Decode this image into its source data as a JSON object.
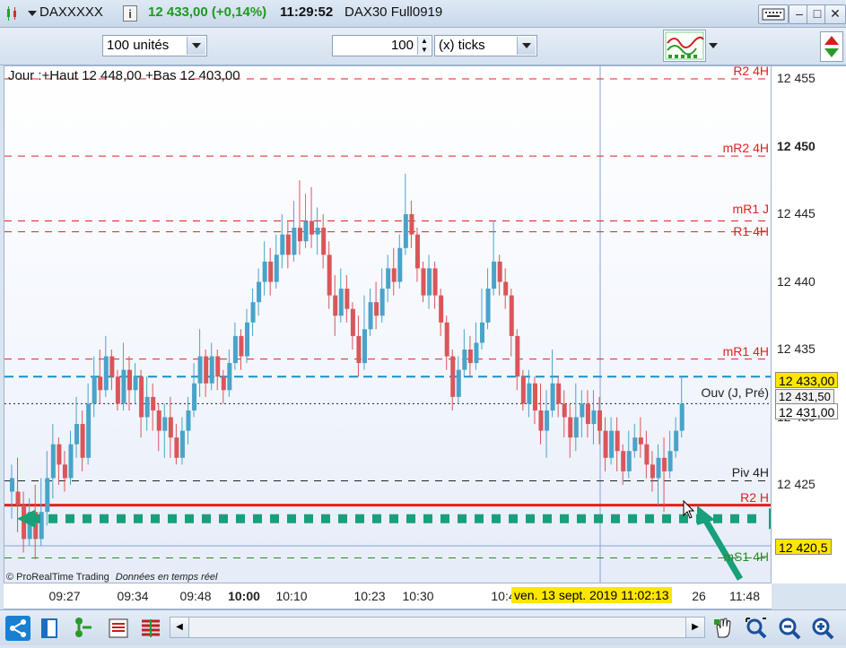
{
  "titlebar": {
    "symbol": "DAXXXXX",
    "info_icon": "i",
    "price_change": "12 433,00 (+0,14%)",
    "time": "11:29:52",
    "contract": "DAX30 Full0919",
    "keyboard_icon": "keyboard-icon",
    "minimize": "–",
    "maximize": "□",
    "close": "✕"
  },
  "toolbar": {
    "units_value": "100 unités",
    "ticks_value": "100",
    "ticks_unit": "(x) ticks"
  },
  "chart": {
    "info_line": "Jour :+Haut 12 448,00 +Bas 12 403,00",
    "copyright": "© ProRealTime Trading",
    "realtime_note": "Données en temps réel",
    "date_label": "ven. 13 sept. 2019 11:02:13"
  },
  "levels": [
    {
      "label": "R2 4H",
      "price": 12455,
      "color": "#e02020"
    },
    {
      "label": "mR2 4H",
      "price": 12449.3,
      "color": "#e02020"
    },
    {
      "label": "mR1 J",
      "price": 12444.5,
      "color": "#e02020"
    },
    {
      "label": "R1 4H",
      "price": 12443.7,
      "color": "#e02020"
    },
    {
      "label": "mR1 4H",
      "price": 12434.3,
      "color": "#e02020"
    },
    {
      "label": "Ouv (J, Pré)",
      "price": 12431.0,
      "color": "#222222"
    },
    {
      "label": "Piv 4H",
      "price": 12425.3,
      "color": "#222222"
    },
    {
      "label": "R2 H",
      "price": 12423.5,
      "color": "#e02020"
    },
    {
      "label": "mS1 4H",
      "price": 12419.6,
      "color": "#2a8a2a"
    }
  ],
  "price_axis": {
    "ticks": [
      "12 455",
      "12 450",
      "12 445",
      "12 440",
      "12 435",
      "12 430",
      "12 425"
    ],
    "current_price": "12 433,00",
    "open_price": "12 431,50",
    "crosshair_price": "12 431,00",
    "cursor_price": "12 420,5"
  },
  "time_axis": {
    "labels": [
      "09:27",
      "09:34",
      "09:48",
      "10:00",
      "10:10",
      "10:23",
      "10:30",
      "10:4",
      "26",
      "11:48"
    ]
  },
  "chart_data": {
    "type": "candlestick",
    "ylim": [
      12418.5,
      12456
    ],
    "candles": [
      [
        12424.5,
        12425.5,
        12422.5,
        12426.5
      ],
      [
        12424.5,
        12423.5,
        12421.5,
        12427.0
      ],
      [
        12423.5,
        12421.0,
        12420.0,
        12424.5
      ],
      [
        12421.0,
        12423.0,
        12420.5,
        12424.0
      ],
      [
        12423.0,
        12421.0,
        12419.5,
        12425.0
      ],
      [
        12421.0,
        12423.0,
        12420.5,
        12425.5
      ],
      [
        12423.0,
        12425.5,
        12422.0,
        12427.5
      ],
      [
        12425.5,
        12428.0,
        12424.0,
        12429.5
      ],
      [
        12428.0,
        12426.5,
        12425.0,
        12428.5
      ],
      [
        12426.5,
        12425.5,
        12424.5,
        12427.5
      ],
      [
        12425.5,
        12428.0,
        12425.0,
        12429.0
      ],
      [
        12428.0,
        12429.5,
        12427.0,
        12431.5
      ],
      [
        12429.5,
        12427.0,
        12426.0,
        12430.5
      ],
      [
        12427.0,
        12431.0,
        12426.5,
        12432.5
      ],
      [
        12431.0,
        12433.0,
        12430.0,
        12434.5
      ],
      [
        12433.0,
        12432.0,
        12431.0,
        12435.0
      ],
      [
        12432.0,
        12434.5,
        12431.5,
        12436.0
      ],
      [
        12434.5,
        12433.0,
        12432.0,
        12435.0
      ],
      [
        12433.0,
        12431.0,
        12430.5,
        12433.5
      ],
      [
        12431.0,
        12433.5,
        12430.5,
        12435.5
      ],
      [
        12433.5,
        12432.0,
        12430.5,
        12434.5
      ],
      [
        12432.0,
        12433.0,
        12431.0,
        12434.0
      ],
      [
        12433.0,
        12430.0,
        12428.5,
        12433.5
      ],
      [
        12430.0,
        12431.5,
        12429.0,
        12433.0
      ],
      [
        12431.5,
        12430.5,
        12429.0,
        12432.5
      ],
      [
        12430.5,
        12429.0,
        12427.5,
        12431.0
      ],
      [
        12429.0,
        12430.0,
        12427.0,
        12431.0
      ],
      [
        12430.0,
        12428.5,
        12427.0,
        12431.5
      ],
      [
        12428.5,
        12427.0,
        12426.5,
        12429.5
      ],
      [
        12427.0,
        12429.0,
        12426.5,
        12430.0
      ],
      [
        12429.0,
        12430.5,
        12428.0,
        12431.5
      ],
      [
        12430.5,
        12432.5,
        12430.0,
        12434.0
      ],
      [
        12432.5,
        12434.5,
        12431.5,
        12436.5
      ],
      [
        12434.5,
        12432.5,
        12431.5,
        12435.0
      ],
      [
        12432.5,
        12434.5,
        12432.0,
        12435.5
      ],
      [
        12434.5,
        12433.0,
        12432.0,
        12435.0
      ],
      [
        12433.0,
        12432.0,
        12431.0,
        12433.5
      ],
      [
        12432.0,
        12434.0,
        12431.5,
        12435.0
      ],
      [
        12434.0,
        12436.0,
        12433.5,
        12437.0
      ],
      [
        12436.0,
        12434.5,
        12433.5,
        12436.5
      ],
      [
        12434.5,
        12437.0,
        12434.0,
        12438.0
      ],
      [
        12437.0,
        12438.5,
        12436.0,
        12439.5
      ],
      [
        12438.5,
        12440.0,
        12437.5,
        12441.0
      ],
      [
        12440.0,
        12441.5,
        12439.0,
        12443.0
      ],
      [
        12441.5,
        12440.0,
        12439.0,
        12442.5
      ],
      [
        12440.0,
        12442.0,
        12439.5,
        12443.5
      ],
      [
        12442.0,
        12443.5,
        12441.0,
        12445.0
      ],
      [
        12443.5,
        12442.0,
        12441.0,
        12444.5
      ],
      [
        12442.0,
        12444.0,
        12441.5,
        12446.0
      ],
      [
        12444.0,
        12443.0,
        12442.0,
        12447.5
      ],
      [
        12443.0,
        12444.5,
        12442.5,
        12446.5
      ],
      [
        12444.5,
        12443.5,
        12442.5,
        12447.0
      ],
      [
        12443.5,
        12444.0,
        12442.0,
        12445.5
      ],
      [
        12444.0,
        12442.0,
        12441.0,
        12445.0
      ],
      [
        12442.0,
        12439.0,
        12438.0,
        12443.0
      ],
      [
        12439.0,
        12437.5,
        12436.0,
        12440.5
      ],
      [
        12437.5,
        12439.5,
        12437.0,
        12441.0
      ],
      [
        12439.5,
        12438.0,
        12437.0,
        12440.5
      ],
      [
        12438.0,
        12436.0,
        12435.0,
        12438.5
      ],
      [
        12436.0,
        12434.0,
        12433.0,
        12437.5
      ],
      [
        12434.0,
        12436.5,
        12433.5,
        12439.0
      ],
      [
        12436.5,
        12438.5,
        12436.0,
        12439.5
      ],
      [
        12438.5,
        12437.5,
        12436.5,
        12440.0
      ],
      [
        12437.5,
        12439.5,
        12437.0,
        12441.0
      ],
      [
        12439.5,
        12441.0,
        12438.5,
        12442.0
      ],
      [
        12441.0,
        12440.0,
        12439.0,
        12442.5
      ],
      [
        12440.0,
        12442.5,
        12439.5,
        12443.5
      ],
      [
        12442.5,
        12445.0,
        12442.0,
        12448.0
      ],
      [
        12445.0,
        12443.5,
        12442.5,
        12446.0
      ],
      [
        12443.5,
        12441.0,
        12440.0,
        12444.0
      ],
      [
        12441.0,
        12439.0,
        12438.5,
        12441.5
      ],
      [
        12439.0,
        12441.0,
        12438.0,
        12442.0
      ],
      [
        12441.0,
        12439.0,
        12438.0,
        12441.5
      ],
      [
        12439.0,
        12437.0,
        12436.0,
        12439.5
      ],
      [
        12437.0,
        12434.5,
        12433.5,
        12437.5
      ],
      [
        12434.5,
        12431.5,
        12430.5,
        12435.0
      ],
      [
        12431.5,
        12433.5,
        12431.0,
        12434.5
      ],
      [
        12433.5,
        12435.0,
        12433.0,
        12436.5
      ],
      [
        12435.0,
        12434.0,
        12433.0,
        12436.0
      ],
      [
        12434.0,
        12435.5,
        12433.5,
        12437.0
      ],
      [
        12435.5,
        12437.0,
        12435.0,
        12439.5
      ],
      [
        12437.0,
        12439.5,
        12436.5,
        12441.0
      ],
      [
        12439.5,
        12441.5,
        12439.0,
        12444.5
      ],
      [
        12441.5,
        12440.0,
        12439.0,
        12442.0
      ],
      [
        12440.0,
        12439.0,
        12438.0,
        12441.0
      ],
      [
        12439.0,
        12436.0,
        12434.5,
        12439.5
      ],
      [
        12436.0,
        12433.0,
        12432.0,
        12436.5
      ],
      [
        12433.0,
        12431.0,
        12430.5,
        12433.5
      ],
      [
        12431.0,
        12432.5,
        12430.0,
        12433.5
      ],
      [
        12432.5,
        12430.5,
        12429.5,
        12433.0
      ],
      [
        12430.5,
        12429.0,
        12428.0,
        12432.5
      ],
      [
        12429.0,
        12430.5,
        12427.0,
        12432.0
      ],
      [
        12430.5,
        12432.5,
        12430.0,
        12435.0
      ],
      [
        12432.5,
        12431.0,
        12430.0,
        12433.0
      ],
      [
        12431.0,
        12430.0,
        12428.5,
        12432.0
      ],
      [
        12430.0,
        12428.5,
        12427.0,
        12431.0
      ],
      [
        12428.5,
        12430.0,
        12427.5,
        12432.5
      ],
      [
        12430.0,
        12431.0,
        12428.5,
        12432.0
      ],
      [
        12431.0,
        12429.5,
        12428.5,
        12432.0
      ],
      [
        12429.5,
        12430.5,
        12428.0,
        12432.0
      ],
      [
        12430.5,
        12429.0,
        12428.0,
        12431.5
      ],
      [
        12429.0,
        12427.0,
        12426.0,
        12430.0
      ],
      [
        12427.0,
        12429.0,
        12426.5,
        12430.0
      ],
      [
        12429.0,
        12427.5,
        12426.0,
        12430.0
      ],
      [
        12427.5,
        12426.0,
        12425.0,
        12428.0
      ],
      [
        12426.0,
        12427.5,
        12425.5,
        12429.0
      ],
      [
        12427.5,
        12428.5,
        12427.0,
        12429.5
      ],
      [
        12428.5,
        12428.0,
        12427.0,
        12430.0
      ],
      [
        12428.0,
        12426.5,
        12425.5,
        12429.0
      ],
      [
        12426.5,
        12425.5,
        12424.5,
        12427.5
      ],
      [
        12425.5,
        12427.0,
        12423.5,
        12428.0
      ],
      [
        12427.0,
        12426.0,
        12423.0,
        12428.5
      ],
      [
        12426.0,
        12427.5,
        12425.5,
        12429.0
      ],
      [
        12427.5,
        12429.0,
        12427.0,
        12430.0
      ],
      [
        12429.0,
        12431.0,
        12428.5,
        12433.0
      ]
    ]
  },
  "bottombar": {
    "share_icon": "share-icon",
    "window_icon": "window-icon",
    "tree_icon": "tree-icon",
    "list_icon": "list-icon",
    "grid_icon": "grid-icon",
    "hand_icon": "hand-icon",
    "zoom_fit_icon": "zoom-fit-icon",
    "zoom_out_icon": "zoom-out-icon",
    "zoom_in_icon": "zoom-in-icon"
  }
}
